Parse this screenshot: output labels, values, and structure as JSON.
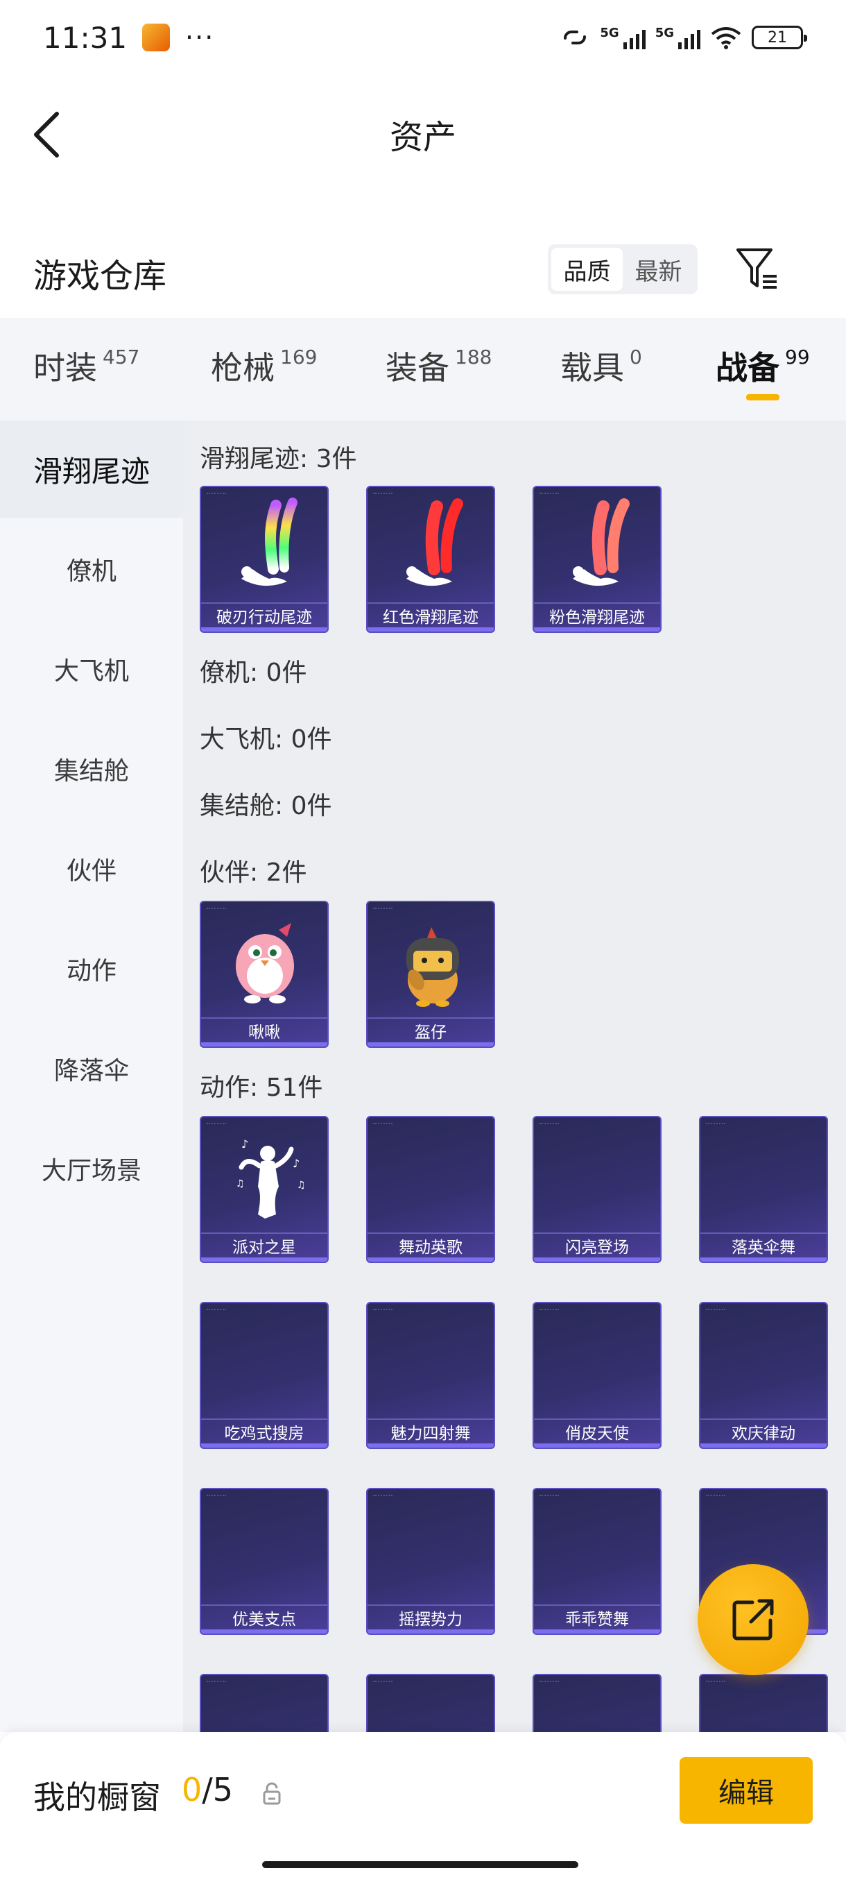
{
  "status_bar": {
    "time": "11:31",
    "more": "···",
    "network_1": "5G",
    "network_2": "5G",
    "battery": "21"
  },
  "header": {
    "title": "资产"
  },
  "warehouse": {
    "title": "游戏仓库",
    "sort_options": [
      {
        "label": "品质",
        "active": true
      },
      {
        "label": "最新",
        "active": false
      }
    ]
  },
  "category_tabs": [
    {
      "name": "时装",
      "count": "457",
      "active": false
    },
    {
      "name": "枪械",
      "count": "169",
      "active": false
    },
    {
      "name": "装备",
      "count": "188",
      "active": false
    },
    {
      "name": "载具",
      "count": "0",
      "active": false
    },
    {
      "name": "战备",
      "count": "99",
      "active": true
    }
  ],
  "sidebar": {
    "items": [
      {
        "label": "滑翔尾迹",
        "active": true
      },
      {
        "label": "僚机",
        "active": false
      },
      {
        "label": "大飞机",
        "active": false
      },
      {
        "label": "集结舱",
        "active": false
      },
      {
        "label": "伙伴",
        "active": false
      },
      {
        "label": "动作",
        "active": false
      },
      {
        "label": "降落伞",
        "active": false
      },
      {
        "label": "大厅场景",
        "active": false
      }
    ]
  },
  "sections": {
    "glide_trails": {
      "label": "滑翔尾迹: 3件",
      "items": [
        "破刃行动尾迹",
        "红色滑翔尾迹",
        "粉色滑翔尾迹"
      ]
    },
    "wingman": {
      "label": "僚机: 0件"
    },
    "big_plane": {
      "label": "大飞机: 0件"
    },
    "rally_pod": {
      "label": "集结舱: 0件"
    },
    "partners": {
      "label": "伙伴: 2件",
      "items": [
        "啾啾",
        "盔仔"
      ]
    },
    "actions": {
      "label": "动作: 51件",
      "items": [
        "派对之星",
        "舞动英歌",
        "闪亮登场",
        "落英伞舞",
        "吃鸡式搜房",
        "魅力四射舞",
        "俏皮天使",
        "欢庆律动",
        "优美支点",
        "摇摆势力",
        "乖乖赞舞"
      ]
    }
  },
  "bottom_bar": {
    "showcase_label": "我的橱窗",
    "showcase_current": "0",
    "showcase_total": "/5",
    "edit_label": "编辑"
  },
  "colors": {
    "accent": "#f7b500",
    "card_bg": "#33306e",
    "card_border": "#5a4ec0"
  }
}
